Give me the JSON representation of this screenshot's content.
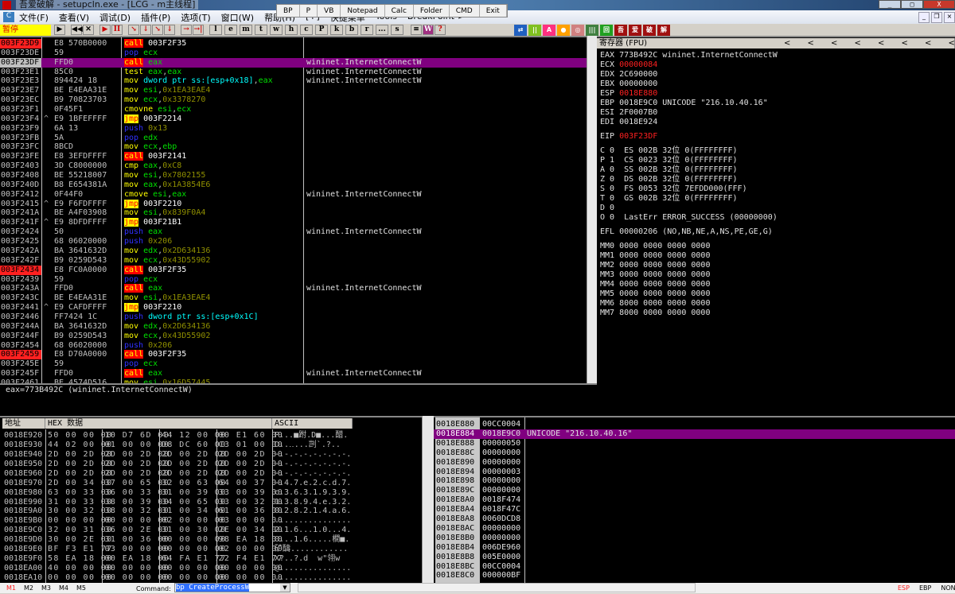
{
  "window": {
    "title": "吾爱破解 - setupcln.exe - [LCG - m主线程]",
    "controls": [
      "_",
      "□",
      "X"
    ]
  },
  "menu": {
    "items": [
      "文件(F)",
      "查看(V)",
      "调试(D)",
      "插件(P)",
      "选项(T)",
      "窗口(W)",
      "帮助(H)",
      "[+]",
      "快捷菜单",
      "Tools",
      "BreakPoint->"
    ],
    "mdi": [
      "_",
      "❐",
      "×"
    ]
  },
  "floating_toolbar": [
    "BP",
    "P",
    "VB",
    "Notepad",
    "Calc",
    "Folder",
    "CMD",
    "Exit"
  ],
  "toolbar": {
    "status": "暂停",
    "buttons": [
      "▶",
      "◀◀",
      "✕",
      "▶",
      "II",
      "↘",
      "↓",
      "↘",
      "↓",
      "→",
      "→|"
    ],
    "letters": [
      "l",
      "e",
      "m",
      "t",
      "w",
      "h",
      "c",
      "P",
      "k",
      "b",
      "r",
      "...",
      "s"
    ],
    "extra": [
      "≡",
      "W",
      "?"
    ],
    "color_icons": [
      {
        "t": "⇄",
        "c": "#2060c0"
      },
      {
        "t": "||",
        "c": "#80c020"
      },
      {
        "t": "A",
        "c": "#ff3080"
      },
      {
        "t": "●",
        "c": "#ffa000"
      },
      {
        "t": "◎",
        "c": "#d08080"
      },
      {
        "t": "|||",
        "c": "#408040"
      },
      {
        "t": "回",
        "c": "#20a020"
      },
      {
        "t": "吾",
        "c": "#a01010"
      },
      {
        "t": "爱",
        "c": "#a01010"
      },
      {
        "t": "破",
        "c": "#a01010"
      },
      {
        "t": "解",
        "c": "#a01010"
      },
      {
        "t": "",
        "c": "#d4d0c8"
      }
    ]
  },
  "disasm": {
    "rows": [
      {
        "addr": "003F23D9",
        "j": "",
        "hex": "E8 570B0000",
        "mn": "call",
        "op": "003F2F35",
        "cm": "",
        "bp": true
      },
      {
        "addr": "003F23DE",
        "j": "",
        "hex": "59",
        "mn": "pop",
        "op": "ecx",
        "cm": ""
      },
      {
        "addr": "003F23DF",
        "j": "",
        "hex": "FFD0",
        "mn": "call",
        "op": "eax",
        "cm": "wininet.InternetConnectW",
        "sel": true
      },
      {
        "addr": "003F23E1",
        "j": "",
        "hex": "85C0",
        "mn": "test",
        "op": "eax,eax",
        "cm": "wininet.InternetConnectW"
      },
      {
        "addr": "003F23E3",
        "j": "",
        "hex": "894424 18",
        "mn": "mov",
        "op": "dword ptr ss:[esp+0x18],eax",
        "cm": "wininet.InternetConnectW"
      },
      {
        "addr": "003F23E7",
        "j": "",
        "hex": "BE E4EAA31E",
        "mn": "mov",
        "op": "esi,0x1EA3EAE4",
        "cm": ""
      },
      {
        "addr": "003F23EC",
        "j": "",
        "hex": "B9 70823703",
        "mn": "mov",
        "op": "ecx,0x3378270",
        "cm": ""
      },
      {
        "addr": "003F23F1",
        "j": "",
        "hex": "0F45F1",
        "mn": "cmovne",
        "op": "esi,ecx",
        "cm": ""
      },
      {
        "addr": "003F23F4",
        "j": "^",
        "hex": "E9 1BFEFFFF",
        "mn": "jmp",
        "op": "003F2214",
        "cm": ""
      },
      {
        "addr": "003F23F9",
        "j": "",
        "hex": "6A 13",
        "mn": "push",
        "op": "0x13",
        "cm": ""
      },
      {
        "addr": "003F23FB",
        "j": "",
        "hex": "5A",
        "mn": "pop",
        "op": "edx",
        "cm": ""
      },
      {
        "addr": "003F23FC",
        "j": "",
        "hex": "8BCD",
        "mn": "mov",
        "op": "ecx,ebp",
        "cm": ""
      },
      {
        "addr": "003F23FE",
        "j": "",
        "hex": "E8 3EFDFFFF",
        "mn": "call",
        "op": "003F2141",
        "cm": ""
      },
      {
        "addr": "003F2403",
        "j": "",
        "hex": "3D C8000000",
        "mn": "cmp",
        "op": "eax,0xC8",
        "cm": ""
      },
      {
        "addr": "003F2408",
        "j": "",
        "hex": "BE 55218007",
        "mn": "mov",
        "op": "esi,0x7802155",
        "cm": ""
      },
      {
        "addr": "003F240D",
        "j": "",
        "hex": "B8 E654381A",
        "mn": "mov",
        "op": "eax,0x1A3854E6",
        "cm": ""
      },
      {
        "addr": "003F2412",
        "j": "",
        "hex": "0F44F0",
        "mn": "cmove",
        "op": "esi,eax",
        "cm": "wininet.InternetConnectW"
      },
      {
        "addr": "003F2415",
        "j": "^",
        "hex": "E9 F6FDFFFF",
        "mn": "jmp",
        "op": "003F2210",
        "cm": ""
      },
      {
        "addr": "003F241A",
        "j": "",
        "hex": "BE A4F03908",
        "mn": "mov",
        "op": "esi,0x839F0A4",
        "cm": ""
      },
      {
        "addr": "003F241F",
        "j": "^",
        "hex": "E9 8DFDFFFF",
        "mn": "jmp",
        "op": "003F21B1",
        "cm": ""
      },
      {
        "addr": "003F2424",
        "j": "",
        "hex": "50",
        "mn": "push",
        "op": "eax",
        "cm": "wininet.InternetConnectW"
      },
      {
        "addr": "003F2425",
        "j": "",
        "hex": "68 06020000",
        "mn": "push",
        "op": "0x206",
        "cm": ""
      },
      {
        "addr": "003F242A",
        "j": "",
        "hex": "BA 3641632D",
        "mn": "mov",
        "op": "edx,0x2D634136",
        "cm": ""
      },
      {
        "addr": "003F242F",
        "j": "",
        "hex": "B9 0259D543",
        "mn": "mov",
        "op": "ecx,0x43D55902",
        "cm": ""
      },
      {
        "addr": "003F2434",
        "j": "",
        "hex": "E8 FC0A0000",
        "mn": "call",
        "op": "003F2F35",
        "cm": "",
        "bp": true
      },
      {
        "addr": "003F2439",
        "j": "",
        "hex": "59",
        "mn": "pop",
        "op": "ecx",
        "cm": ""
      },
      {
        "addr": "003F243A",
        "j": "",
        "hex": "FFD0",
        "mn": "call",
        "op": "eax",
        "cm": "wininet.InternetConnectW"
      },
      {
        "addr": "003F243C",
        "j": "",
        "hex": "BE E4EAA31E",
        "mn": "mov",
        "op": "esi,0x1EA3EAE4",
        "cm": ""
      },
      {
        "addr": "003F2441",
        "j": "^",
        "hex": "E9 CAFDFFFF",
        "mn": "jmp",
        "op": "003F2210",
        "cm": ""
      },
      {
        "addr": "003F2446",
        "j": "",
        "hex": "FF7424 1C",
        "mn": "push",
        "op": "dword ptr ss:[esp+0x1C]",
        "cm": ""
      },
      {
        "addr": "003F244A",
        "j": "",
        "hex": "BA 3641632D",
        "mn": "mov",
        "op": "edx,0x2D634136",
        "cm": ""
      },
      {
        "addr": "003F244F",
        "j": "",
        "hex": "B9 0259D543",
        "mn": "mov",
        "op": "ecx,0x43D55902",
        "cm": ""
      },
      {
        "addr": "003F2454",
        "j": "",
        "hex": "68 06020000",
        "mn": "push",
        "op": "0x206",
        "cm": ""
      },
      {
        "addr": "003F2459",
        "j": "",
        "hex": "E8 D70A0000",
        "mn": "call",
        "op": "003F2F35",
        "cm": "",
        "bp": true
      },
      {
        "addr": "003F245E",
        "j": "",
        "hex": "59",
        "mn": "pop",
        "op": "ecx",
        "cm": ""
      },
      {
        "addr": "003F245F",
        "j": "",
        "hex": "FFD0",
        "mn": "call",
        "op": "eax",
        "cm": "wininet.InternetConnectW"
      },
      {
        "addr": "003F2461",
        "j": "",
        "hex": "BE 4574D516",
        "mn": "mov",
        "op": "esi,0x16D57445",
        "cm": ""
      }
    ]
  },
  "info": {
    "text": "eax=773B492C (wininet.InternetConnectW)"
  },
  "registers": {
    "title": "寄存器 (FPU)",
    "arrows": [
      "<",
      "<",
      "<",
      "<",
      "<",
      "<",
      "<",
      "<"
    ],
    "lines": [
      {
        "t": "EAX 773B492C wininet.InternetConnectW"
      },
      {
        "n": "ECX ",
        "v": "00000084",
        "red": true
      },
      {
        "t": "EDX 2C690000"
      },
      {
        "t": "EBX 00000000"
      },
      {
        "n": "ESP ",
        "v": "0018E880",
        "red": true
      },
      {
        "t": "EBP 0018E9C0 UNICODE \"216.10.40.16\""
      },
      {
        "t": "ESI 2F0007B0"
      },
      {
        "t": "EDI 0018E924"
      },
      {
        "t": ""
      },
      {
        "n": "EIP ",
        "v": "003F23DF",
        "red": true
      },
      {
        "t": ""
      },
      {
        "t": "C 0  ES 002B 32位 0(FFFFFFFF)"
      },
      {
        "t": "P 1  CS 0023 32位 0(FFFFFFFF)"
      },
      {
        "t": "A 0  SS 002B 32位 0(FFFFFFFF)"
      },
      {
        "t": "Z 0  DS 002B 32位 0(FFFFFFFF)"
      },
      {
        "t": "S 0  FS 0053 32位 7EFDD000(FFF)"
      },
      {
        "t": "T 0  GS 002B 32位 0(FFFFFFFF)"
      },
      {
        "t": "D 0"
      },
      {
        "t": "O 0  LastErr ERROR_SUCCESS (00000000)"
      },
      {
        "t": ""
      },
      {
        "t": "EFL 00000206 (NO,NB,NE,A,NS,PE,GE,G)"
      },
      {
        "t": ""
      },
      {
        "t": "MM0 0000 0000 0000 0000"
      },
      {
        "t": "MM1 0000 0000 0000 0000"
      },
      {
        "t": "MM2 0000 0000 0000 0000"
      },
      {
        "t": "MM3 0000 0000 0000 0000"
      },
      {
        "t": "MM4 0000 0000 0000 0000"
      },
      {
        "t": "MM5 0000 0000 0000 0000"
      },
      {
        "t": "MM6 8000 0000 0000 0000"
      },
      {
        "t": "MM7 8000 0000 0000 0000"
      }
    ]
  },
  "dump": {
    "headers": [
      "地址",
      "HEX 数据",
      "ASCII"
    ],
    "rows": [
      {
        "a": "0018E920",
        "h": [
          "50 00 00 00",
          "10 D7 6D 00",
          "44 12 00 00",
          "00 E1 60 00"
        ],
        "s": "P...■跗.D■...醋."
      },
      {
        "a": "0018E930",
        "h": [
          "44 02 00 00",
          "01 00 00 00",
          "D8 DC 60 00",
          "C3 01 00 00"
        ],
        "s": "D..‥...剀`.?.."
      },
      {
        "a": "0018E940",
        "h": [
          "2D 00 2D 00",
          "2D 00 2D 00",
          "2D 00 2D 00",
          "2D 00 2D 00"
        ],
        "s": "-.-.-.-.-.-.-.-."
      },
      {
        "a": "0018E950",
        "h": [
          "2D 00 2D 00",
          "2D 00 2D 00",
          "2D 00 2D 00",
          "2D 00 2D 00"
        ],
        "s": "-.-.-.-.-.-.-.-."
      },
      {
        "a": "0018E960",
        "h": [
          "2D 00 2D 00",
          "2D 00 2D 00",
          "2D 00 2D 00",
          "2D 00 2D 00"
        ],
        "s": "-.-.-.-.-.-.-.-."
      },
      {
        "a": "0018E970",
        "h": [
          "2D 00 34 00",
          "37 00 65 00",
          "32 00 63 00",
          "64 00 37 00"
        ],
        "s": "-.4.7.e.2.c.d.7."
      },
      {
        "a": "0018E980",
        "h": [
          "63 00 33 00",
          "36 00 33 00",
          "31 00 39 00",
          "33 00 39 00"
        ],
        "s": "c.3.6.3.1.9.3.9."
      },
      {
        "a": "0018E990",
        "h": [
          "31 00 33 00",
          "38 00 39 00",
          "34 00 65 00",
          "33 00 32 00"
        ],
        "s": "1.3.8.9.4.e.3.2."
      },
      {
        "a": "0018E9A0",
        "h": [
          "30 00 32 00",
          "38 00 32 00",
          "31 00 34 00",
          "61 00 36 00"
        ],
        "s": "0.2.8.2.1.4.a.6."
      },
      {
        "a": "0018E9B0",
        "h": [
          "00 00 00 00",
          "00 00 00 00",
          "02 00 00 00",
          "03 00 00 00"
        ],
        "s": "................"
      },
      {
        "a": "0018E9C0",
        "h": [
          "32 00 31 00",
          "36 00 2E 00",
          "31 00 30 00",
          "2E 00 34 00"
        ],
        "s": "2.1.6...1.0...4."
      },
      {
        "a": "0018E9D0",
        "h": [
          "30 00 2E 00",
          "31 00 36 00",
          "00 00 00 00",
          "98 EA 18 00"
        ],
        "s": "0...1.6.....橺■."
      },
      {
        "a": "0018E9E0",
        "h": [
          "BF F3 E1 77",
          "03 00 00 00",
          "00 00 00 00",
          "02 00 00 00"
        ],
        "s": "矿醻............"
      },
      {
        "a": "0018E9F0",
        "h": [
          "58 EA 18 00",
          "00 EA 18 00",
          "64 FA E1 77",
          "22 F4 E1 77"
        ],
        "s": "X?..?.d  w\"翎w"
      },
      {
        "a": "0018EA00",
        "h": [
          "40 00 00 00",
          "00 00 00 00",
          "00 00 00 00",
          "00 00 00 00"
        ],
        "s": "@..............."
      },
      {
        "a": "0018EA10",
        "h": [
          "00 00 00 00",
          "00 00 00 00",
          "00 00 00 00",
          "00 00 00 00"
        ],
        "s": "................"
      }
    ]
  },
  "stack": {
    "rows": [
      {
        "a": "0018E880",
        "v": "00CC0004",
        "c": ""
      },
      {
        "a": "0018E884",
        "v": "0018E9C0",
        "c": "UNICODE \"216.10.40.16\"",
        "sel": true
      },
      {
        "a": "0018E888",
        "v": "00000050",
        "c": ""
      },
      {
        "a": "0018E88C",
        "v": "00000000",
        "c": ""
      },
      {
        "a": "0018E890",
        "v": "00000000",
        "c": ""
      },
      {
        "a": "0018E894",
        "v": "00000003",
        "c": ""
      },
      {
        "a": "0018E898",
        "v": "00000000",
        "c": ""
      },
      {
        "a": "0018E89C",
        "v": "00000000",
        "c": ""
      },
      {
        "a": "0018E8A0",
        "v": "0018F474",
        "c": ""
      },
      {
        "a": "0018E8A4",
        "v": "0018F47C",
        "c": ""
      },
      {
        "a": "0018E8A8",
        "v": "0060DCD8",
        "c": ""
      },
      {
        "a": "0018E8AC",
        "v": "00000000",
        "c": ""
      },
      {
        "a": "0018E8B0",
        "v": "00000000",
        "c": ""
      },
      {
        "a": "0018E8B4",
        "v": "006DE960",
        "c": ""
      },
      {
        "a": "0018E8B8",
        "v": "005E0000",
        "c": ""
      },
      {
        "a": "0018E8BC",
        "v": "00CC0004",
        "c": ""
      },
      {
        "a": "0018E8C0",
        "v": "000000BF",
        "c": ""
      }
    ]
  },
  "statusbar": {
    "dump_tabs": [
      "M1",
      "M2",
      "M3",
      "M4",
      "M5"
    ],
    "active_tab": "M1",
    "command_label": "Command:",
    "command_value": "bp CreateProcessW",
    "right": [
      "ESP",
      "EBP",
      "NONE"
    ],
    "active_right": "ESP"
  }
}
